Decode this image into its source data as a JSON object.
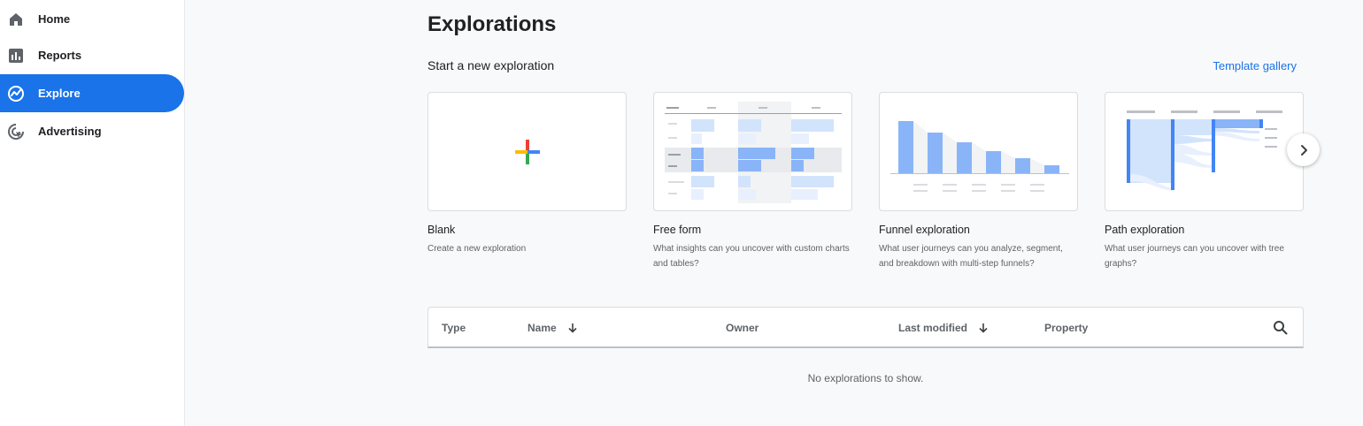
{
  "sidebar": {
    "items": [
      {
        "label": "Home",
        "icon": "home-icon"
      },
      {
        "label": "Reports",
        "icon": "reports-icon"
      },
      {
        "label": "Explore",
        "icon": "explore-icon",
        "active": true
      },
      {
        "label": "Advertising",
        "icon": "advertising-icon"
      }
    ]
  },
  "main": {
    "title": "Explorations",
    "section_title": "Start a new exploration",
    "template_link": "Template gallery",
    "cards": [
      {
        "title": "Blank",
        "description": "Create a new exploration"
      },
      {
        "title": "Free form",
        "description": "What insights can you uncover with custom charts and tables?"
      },
      {
        "title": "Funnel exploration",
        "description": "What user journeys can you analyze, segment, and breakdown with multi-step funnels?"
      },
      {
        "title": "Path exploration",
        "description": "What user journeys can you uncover with tree graphs?"
      }
    ],
    "table": {
      "columns": [
        "Type",
        "Name",
        "Owner",
        "Last modified",
        "Property"
      ],
      "empty_message": "No explorations to show."
    }
  },
  "colors": {
    "accent": "#1a73e8",
    "bar_blue": "#8ab4f8",
    "bar_light": "#d2e3fc",
    "google_blue": "#4285f4",
    "google_red": "#ea4335",
    "google_yellow": "#fbbc04",
    "google_green": "#34a853"
  }
}
